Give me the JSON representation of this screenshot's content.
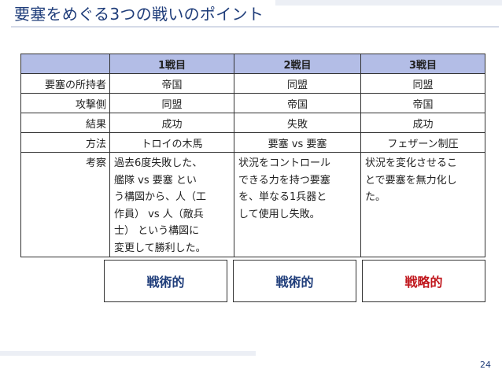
{
  "slide": {
    "title": "要塞をめぐる3つの戦いのポイント",
    "page_number": "24"
  },
  "table": {
    "headers": [
      "",
      "1戦目",
      "2戦目",
      "3戦目"
    ],
    "rows": [
      {
        "label": "要塞の所持者",
        "cells": [
          "帝国",
          "同盟",
          "同盟"
        ]
      },
      {
        "label": "攻撃側",
        "cells": [
          "同盟",
          "帝国",
          "帝国"
        ]
      },
      {
        "label": "結果",
        "cells": [
          "成功",
          "失敗",
          "成功"
        ]
      },
      {
        "label": "方法",
        "cells": [
          "トロイの木馬",
          "要塞 vs 要塞",
          "フェザーン制圧"
        ]
      }
    ],
    "reason_row": {
      "label": "考察",
      "cells": [
        [
          "過去6度失敗した、",
          "艦隊 vs 要塞 とい",
          "う構図から、人（工",
          "作員） vs 人（敵兵",
          "士） という構図に",
          "変更して勝利した。"
        ],
        [
          "状況をコントロール",
          "できる力を持つ要塞",
          "を、単なる1兵器と",
          "して使用し失敗。"
        ],
        [
          "状況を変化させるこ",
          "とで要塞を無力化し",
          "た。"
        ]
      ]
    }
  },
  "verdicts": [
    {
      "label": "戦術的",
      "color": "#1f3d7a"
    },
    {
      "label": "戦術的",
      "color": "#1f3d7a"
    },
    {
      "label": "戦略的",
      "color": "#c0161c"
    }
  ]
}
